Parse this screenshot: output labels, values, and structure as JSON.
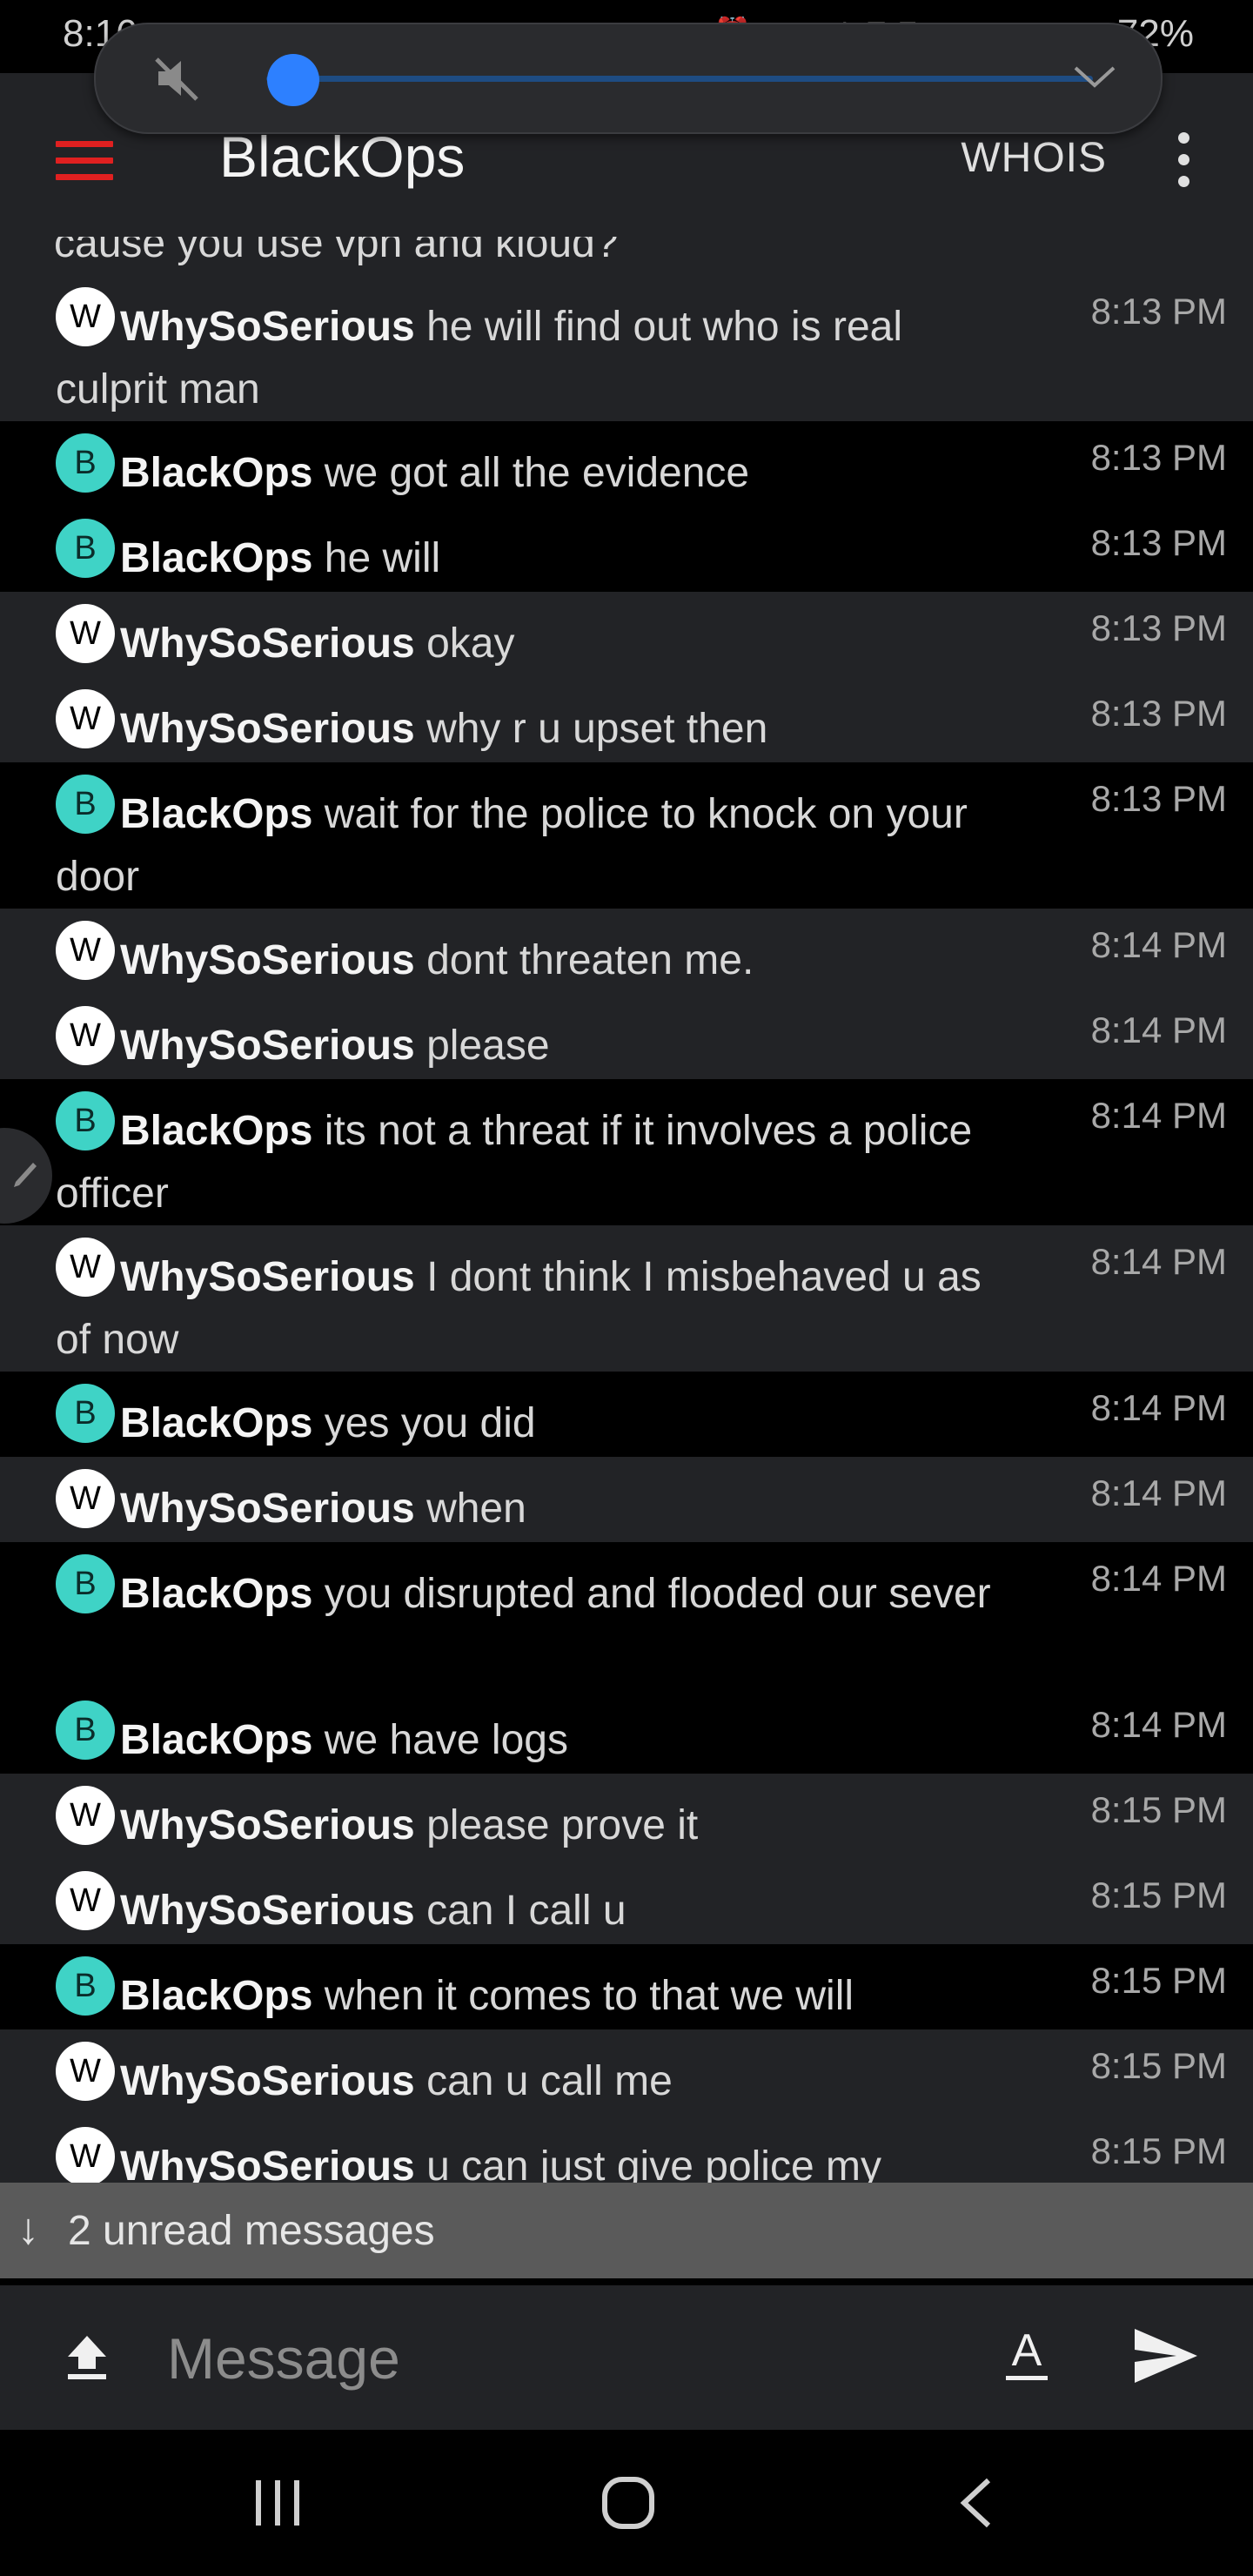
{
  "status_bar": {
    "time": "8:16",
    "battery": "72%",
    "mid_icons": "▣ ● ● •",
    "right_icons": "⏰ ✕ LTE ▂▄▆"
  },
  "volume_overlay": {
    "mute_icon": "speaker-muted-icon",
    "level": 0.03,
    "accent_color": "#2d80ff"
  },
  "header": {
    "menu_icon": "hamburger-menu-icon",
    "menu_color": "#e02020",
    "title": "BlackOps",
    "whois_label": "WHOIS",
    "overflow_icon": "kebab-menu-icon"
  },
  "chat": {
    "clipped_top_text": "cause you use vpn and kloud?",
    "messages": [
      {
        "avatar": "W",
        "nick": "WhySoSerious",
        "text": "he will find out who is real culprit man",
        "time": "8:13 PM"
      },
      {
        "avatar": "B",
        "nick": "BlackOps",
        "text": "we got all the evidence",
        "time": "8:13 PM"
      },
      {
        "avatar": "B",
        "nick": "BlackOps",
        "text": "he will",
        "time": "8:13 PM"
      },
      {
        "avatar": "W",
        "nick": "WhySoSerious",
        "text": "okay",
        "time": "8:13 PM"
      },
      {
        "avatar": "W",
        "nick": "WhySoSerious",
        "text": "why r u upset then",
        "time": "8:13 PM"
      },
      {
        "avatar": "B",
        "nick": "BlackOps",
        "text": "wait for the police to knock on your door",
        "time": "8:13 PM"
      },
      {
        "avatar": "W",
        "nick": "WhySoSerious",
        "text": "dont threaten  me.",
        "time": "8:14 PM"
      },
      {
        "avatar": "W",
        "nick": "WhySoSerious",
        "text": "please",
        "time": "8:14 PM"
      },
      {
        "avatar": "B",
        "nick": "BlackOps",
        "text": "its not a threat if it involves a police officer",
        "time": "8:14 PM"
      },
      {
        "avatar": "W",
        "nick": "WhySoSerious",
        "text": "I dont think I misbehaved u as of now",
        "time": "8:14 PM"
      },
      {
        "avatar": "B",
        "nick": "BlackOps",
        "text": "yes you did",
        "time": "8:14 PM"
      },
      {
        "avatar": "W",
        "nick": "WhySoSerious",
        "text": "when",
        "time": "8:14 PM"
      },
      {
        "avatar": "B",
        "nick": "BlackOps",
        "text": "you disrupted and flooded our sever",
        "time": "8:14 PM"
      },
      {
        "avatar": "B",
        "nick": "BlackOps",
        "text": "we have logs",
        "time": "8:14 PM"
      },
      {
        "avatar": "W",
        "nick": "WhySoSerious",
        "text": "please prove it",
        "time": "8:15 PM"
      },
      {
        "avatar": "W",
        "nick": "WhySoSerious",
        "text": "can I call u",
        "time": "8:15 PM"
      },
      {
        "avatar": "B",
        "nick": "BlackOps",
        "text": "when it comes to that we will",
        "time": "8:15 PM"
      },
      {
        "avatar": "W",
        "nick": "WhySoSerious",
        "text": "can u call me",
        "time": "8:15 PM"
      },
      {
        "avatar": "W",
        "nick": "WhySoSerious",
        "text": "u can just give police my",
        "time": "8:15 PM"
      }
    ]
  },
  "unread": {
    "arrow": "↓",
    "label": "2 unread messages"
  },
  "composer": {
    "upload_icon": "upload-icon",
    "placeholder": "Message",
    "format_icon": "text-format-icon",
    "send_icon": "send-icon"
  },
  "nav": {
    "recent_icon": "recent-apps-icon",
    "home_icon": "home-icon",
    "back_icon": "back-icon"
  }
}
